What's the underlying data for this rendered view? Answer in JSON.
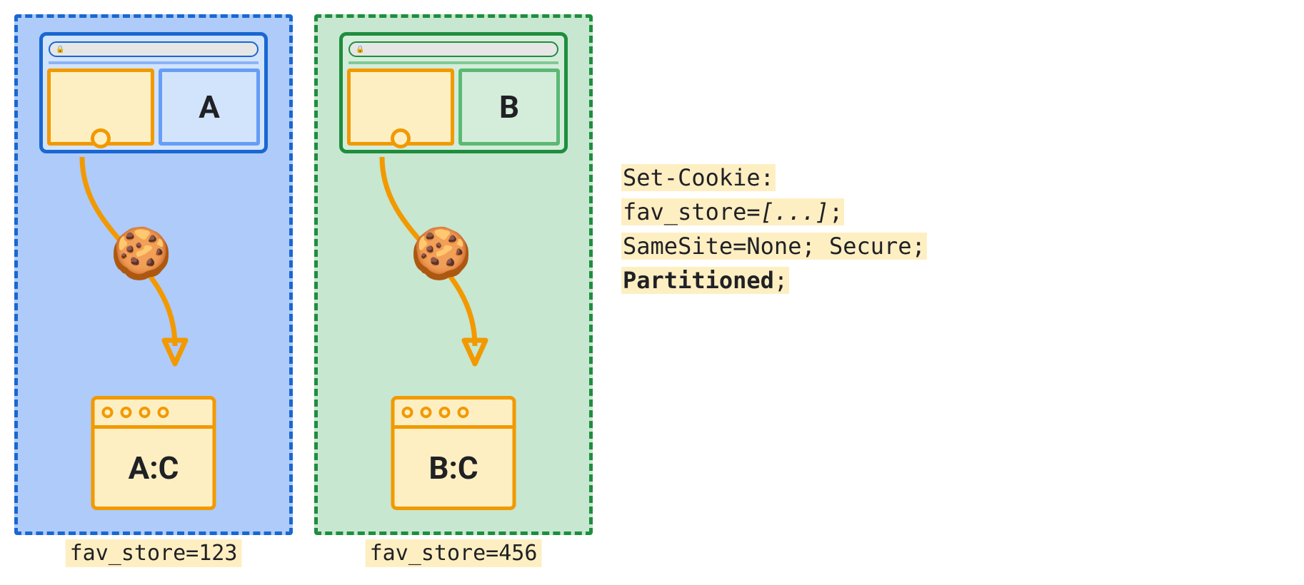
{
  "partitions": [
    {
      "site_label": "A",
      "storage_label": "A:C",
      "caption": "fav_store=123",
      "theme": "blue"
    },
    {
      "site_label": "B",
      "storage_label": "B:C",
      "caption": "fav_store=456",
      "theme": "green"
    }
  ],
  "code": {
    "line1": "Set-Cookie:",
    "line2_prefix": "fav_store=",
    "line2_value": "[...]",
    "line2_suffix": ";",
    "line3": "SameSite=None; Secure;",
    "line4": "Partitioned",
    "line4_suffix": ";"
  },
  "icons": {
    "cookie": "🍪",
    "lock": "🔒"
  }
}
